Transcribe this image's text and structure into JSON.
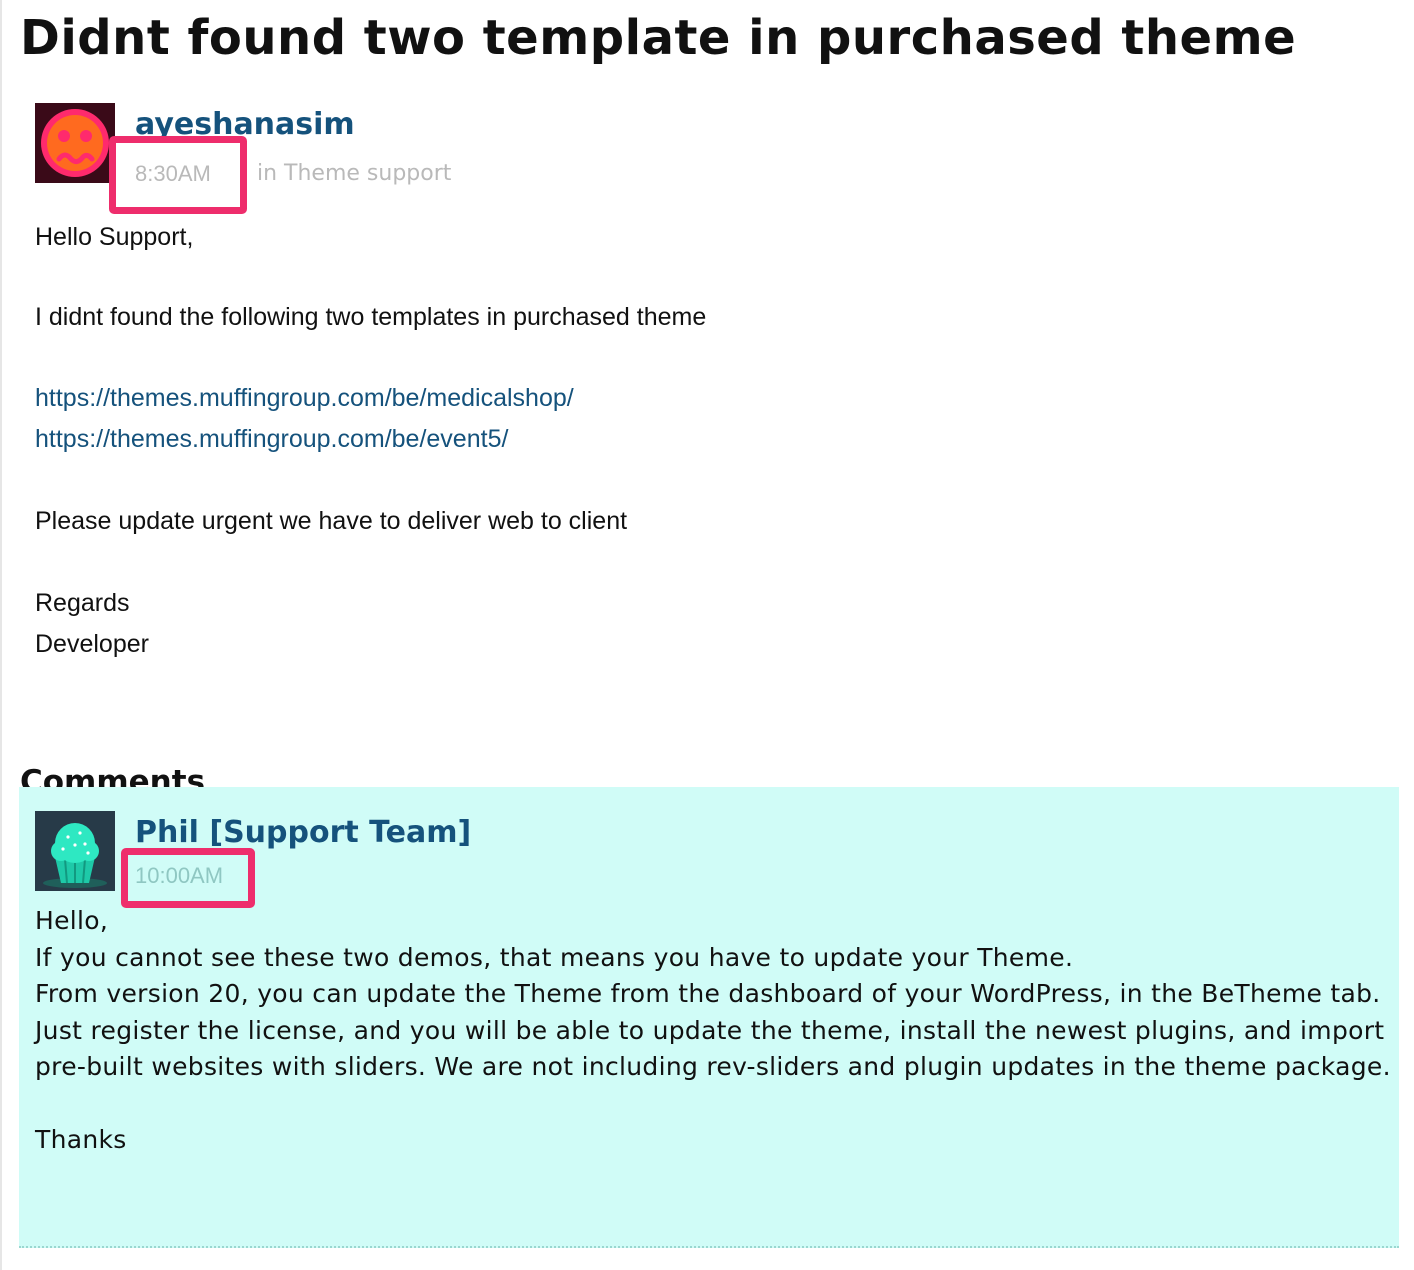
{
  "page": {
    "title": "Didnt found two template in purchased theme"
  },
  "post": {
    "author": "ayeshanasim",
    "time": "8:30AM",
    "category": "in Theme support",
    "lines": [
      "Hello Support,",
      "I didnt found the following two templates in purchased theme",
      "https://themes.muffingroup.com/be/medicalshop/",
      "https://themes.muffingroup.com/be/event5/",
      "Please update urgent we have to deliver web to client",
      "Regards",
      "Developer"
    ]
  },
  "comments": {
    "heading": "Comments",
    "items": [
      {
        "author": "Phil [Support Team]",
        "time": "10:00AM",
        "lines": [
          "Hello,",
          "If you cannot see these two demos, that means you have to update your Theme.",
          "From version 20, you can update the Theme from the dashboard of your WordPress, in the BeTheme tab.",
          "Just register the license, and you will be able to update the theme, install the newest plugins, and import",
          "pre-built websites with sliders. We are not including rev-sliders and plugin updates in the theme package.",
          "Thanks"
        ]
      }
    ]
  },
  "colors": {
    "link": "#15527c",
    "highlight": "#ee2d6c",
    "comment_bg": "#d0fcf7",
    "meta": "#b9b9b9"
  },
  "icons": {
    "post_avatar": "sad-face-avatar-icon",
    "comment_avatar": "cupcake-avatar-icon"
  }
}
